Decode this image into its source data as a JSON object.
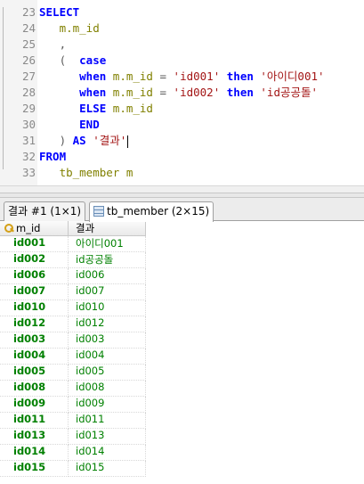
{
  "editor": {
    "lines": [
      {
        "num": "23",
        "tokens": [
          {
            "t": "SELECT",
            "c": "kw"
          }
        ]
      },
      {
        "num": "24",
        "tokens": [
          {
            "t": "   m.m_id",
            "c": "id"
          }
        ]
      },
      {
        "num": "25",
        "tokens": [
          {
            "t": "   ,",
            "c": "op"
          }
        ]
      },
      {
        "num": "26",
        "tokens": [
          {
            "t": "   (  ",
            "c": "op"
          },
          {
            "t": "case",
            "c": "kw"
          }
        ]
      },
      {
        "num": "27",
        "tokens": [
          {
            "t": "      ",
            "c": "op"
          },
          {
            "t": "when",
            "c": "kw"
          },
          {
            "t": " m.m_id ",
            "c": "id"
          },
          {
            "t": "= ",
            "c": "op"
          },
          {
            "t": "'id001'",
            "c": "str"
          },
          {
            "t": " ",
            "c": "op"
          },
          {
            "t": "then",
            "c": "kw"
          },
          {
            "t": " '아이디001'",
            "c": "str"
          }
        ]
      },
      {
        "num": "28",
        "tokens": [
          {
            "t": "      ",
            "c": "op"
          },
          {
            "t": "when",
            "c": "kw"
          },
          {
            "t": " m.m_id ",
            "c": "id"
          },
          {
            "t": "= ",
            "c": "op"
          },
          {
            "t": "'id002'",
            "c": "str"
          },
          {
            "t": " ",
            "c": "op"
          },
          {
            "t": "then",
            "c": "kw"
          },
          {
            "t": " 'id공공돌'",
            "c": "str"
          }
        ]
      },
      {
        "num": "29",
        "tokens": [
          {
            "t": "      ",
            "c": "op"
          },
          {
            "t": "ELSE",
            "c": "kw"
          },
          {
            "t": " m.m_id",
            "c": "id"
          }
        ]
      },
      {
        "num": "30",
        "tokens": [
          {
            "t": "      ",
            "c": "op"
          },
          {
            "t": "END",
            "c": "kw"
          }
        ]
      },
      {
        "num": "31",
        "tokens": [
          {
            "t": "   ) ",
            "c": "op"
          },
          {
            "t": "AS",
            "c": "kw"
          },
          {
            "t": " '결과'",
            "c": "str"
          }
        ],
        "caret": true
      },
      {
        "num": "32",
        "tokens": [
          {
            "t": "FROM",
            "c": "kw"
          }
        ]
      },
      {
        "num": "33",
        "tokens": [
          {
            "t": "   tb_member m",
            "c": "id"
          }
        ]
      }
    ]
  },
  "tabs": [
    {
      "label": "결과 #1 (1×1)",
      "active": false
    },
    {
      "label": "tb_member (2×15)",
      "active": true,
      "icon": "table-icon"
    }
  ],
  "grid": {
    "columns": [
      "m_id",
      "결과"
    ],
    "key_column_icon": "key-icon",
    "rows": [
      [
        "id001",
        "아이디001"
      ],
      [
        "id002",
        "id공공돌"
      ],
      [
        "id006",
        "id006"
      ],
      [
        "id007",
        "id007"
      ],
      [
        "id010",
        "id010"
      ],
      [
        "id012",
        "id012"
      ],
      [
        "id003",
        "id003"
      ],
      [
        "id004",
        "id004"
      ],
      [
        "id005",
        "id005"
      ],
      [
        "id008",
        "id008"
      ],
      [
        "id009",
        "id009"
      ],
      [
        "id011",
        "id011"
      ],
      [
        "id013",
        "id013"
      ],
      [
        "id014",
        "id014"
      ],
      [
        "id015",
        "id015"
      ]
    ]
  }
}
